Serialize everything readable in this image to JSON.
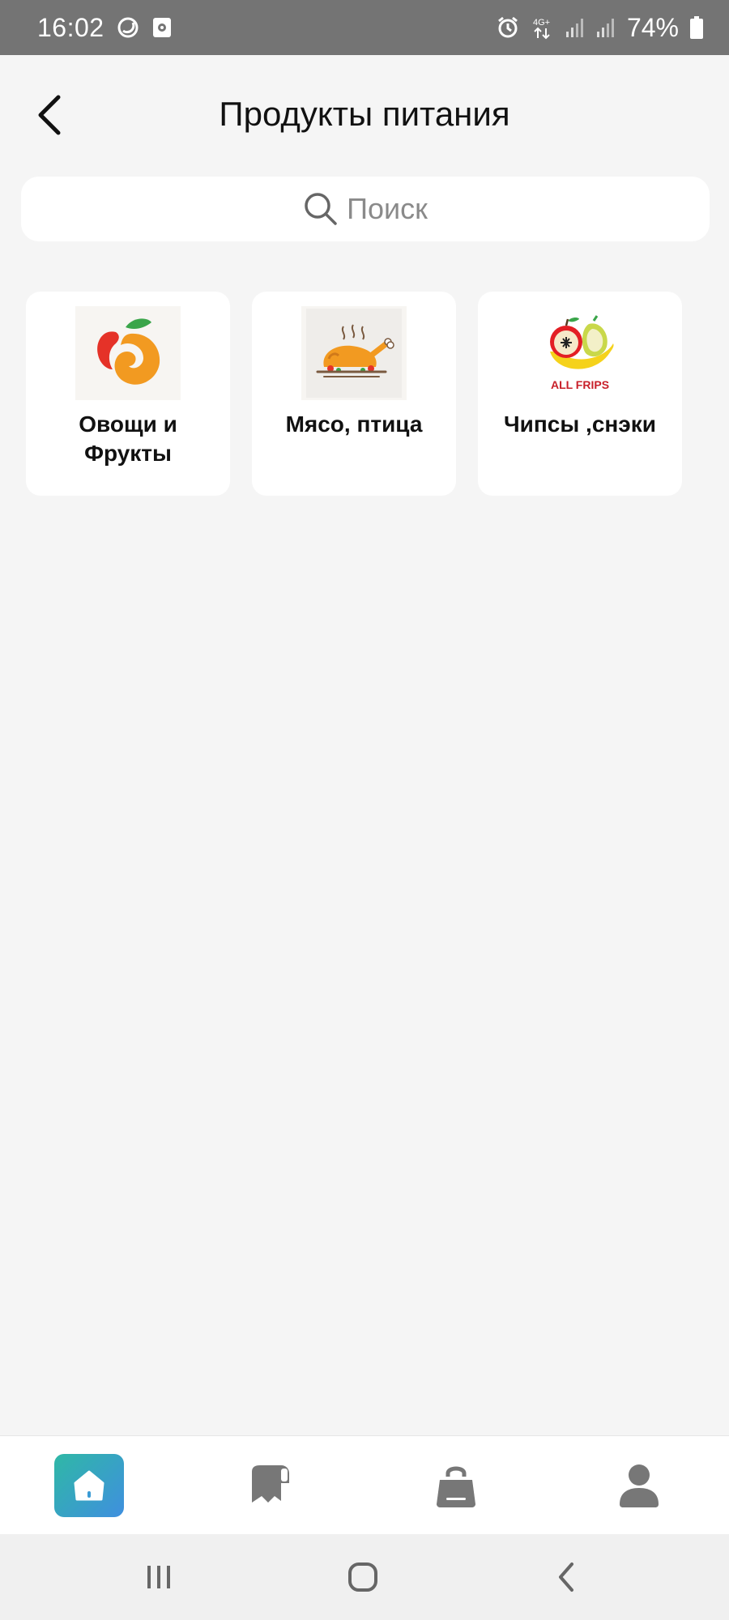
{
  "status_bar": {
    "time": "16:02",
    "network": "4G+",
    "battery": "74%"
  },
  "header": {
    "title": "Продукты питания",
    "back_icon": "chevron-left-icon"
  },
  "search": {
    "placeholder": "Поиск",
    "icon": "search-icon"
  },
  "categories": [
    {
      "label": "Овощи и Фрукты",
      "image": "fruit-logo"
    },
    {
      "label": "Мясо, птица",
      "image": "roast-chicken"
    },
    {
      "label": "Чипсы ,снэки",
      "image": "all-frips-logo",
      "logo_text": "ALL FRIPS"
    }
  ],
  "bottom_nav": {
    "items": [
      {
        "icon": "home-icon",
        "active": true
      },
      {
        "icon": "catalog-icon",
        "active": false
      },
      {
        "icon": "shopping-bag-icon",
        "active": false
      },
      {
        "icon": "profile-icon",
        "active": false
      }
    ],
    "active_color": "#3a9bd5",
    "inactive_color": "#777777"
  },
  "system_nav": {
    "items": [
      "recents-icon",
      "home-outline-icon",
      "back-icon"
    ]
  }
}
